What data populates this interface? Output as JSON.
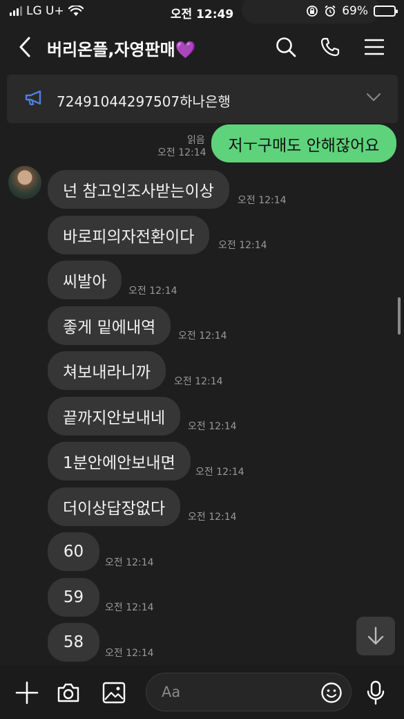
{
  "status_bar": {
    "carrier": "LG U+",
    "time": "오전 12:49",
    "battery_percent": "69%",
    "battery_level": 0.69
  },
  "header": {
    "title": "버리온플,자영판매💜"
  },
  "notice": {
    "text": "72491044297507하나은행"
  },
  "sent_message": {
    "text": "저ㅜ구매도 안해잖어요",
    "read_label": "읽음",
    "time": "오전 12:14"
  },
  "received_messages": [
    {
      "text": "넌 참고인조사받는이상",
      "time": "오전 12:14"
    },
    {
      "text": "바로피의자전환이다",
      "time": "오전 12:14"
    },
    {
      "text": "씨발아",
      "time": "오전 12:14"
    },
    {
      "text": "좋게 밑에내역",
      "time": "오전 12:14"
    },
    {
      "text": "쳐보내라니까",
      "time": "오전 12:14"
    },
    {
      "text": "끝까지안보내네",
      "time": "오전 12:14"
    },
    {
      "text": "1분안에안보내면",
      "time": "오전 12:14"
    },
    {
      "text": "더이상답장없다",
      "time": "오전 12:14"
    },
    {
      "text": "60",
      "time": "오전 12:14"
    },
    {
      "text": "59",
      "time": "오전 12:14"
    },
    {
      "text": "58",
      "time": "오전 12:14"
    }
  ],
  "input": {
    "placeholder": "Aa"
  },
  "icons": {
    "back": "chevron-left-icon",
    "search": "search-icon",
    "call": "phone-icon",
    "menu": "hamburger-menu-icon",
    "notice": "megaphone-icon",
    "expand": "chevron-down-icon",
    "jump": "arrow-down-icon",
    "add": "plus-icon",
    "camera": "camera-icon",
    "gallery": "image-icon",
    "emoji": "emoji-icon",
    "mic": "microphone-icon"
  },
  "colors": {
    "sent_bubble": "#5fd27c",
    "received_bubble": "#363636",
    "background": "#1e1e1e",
    "notice_icon": "#4f7fe0"
  }
}
